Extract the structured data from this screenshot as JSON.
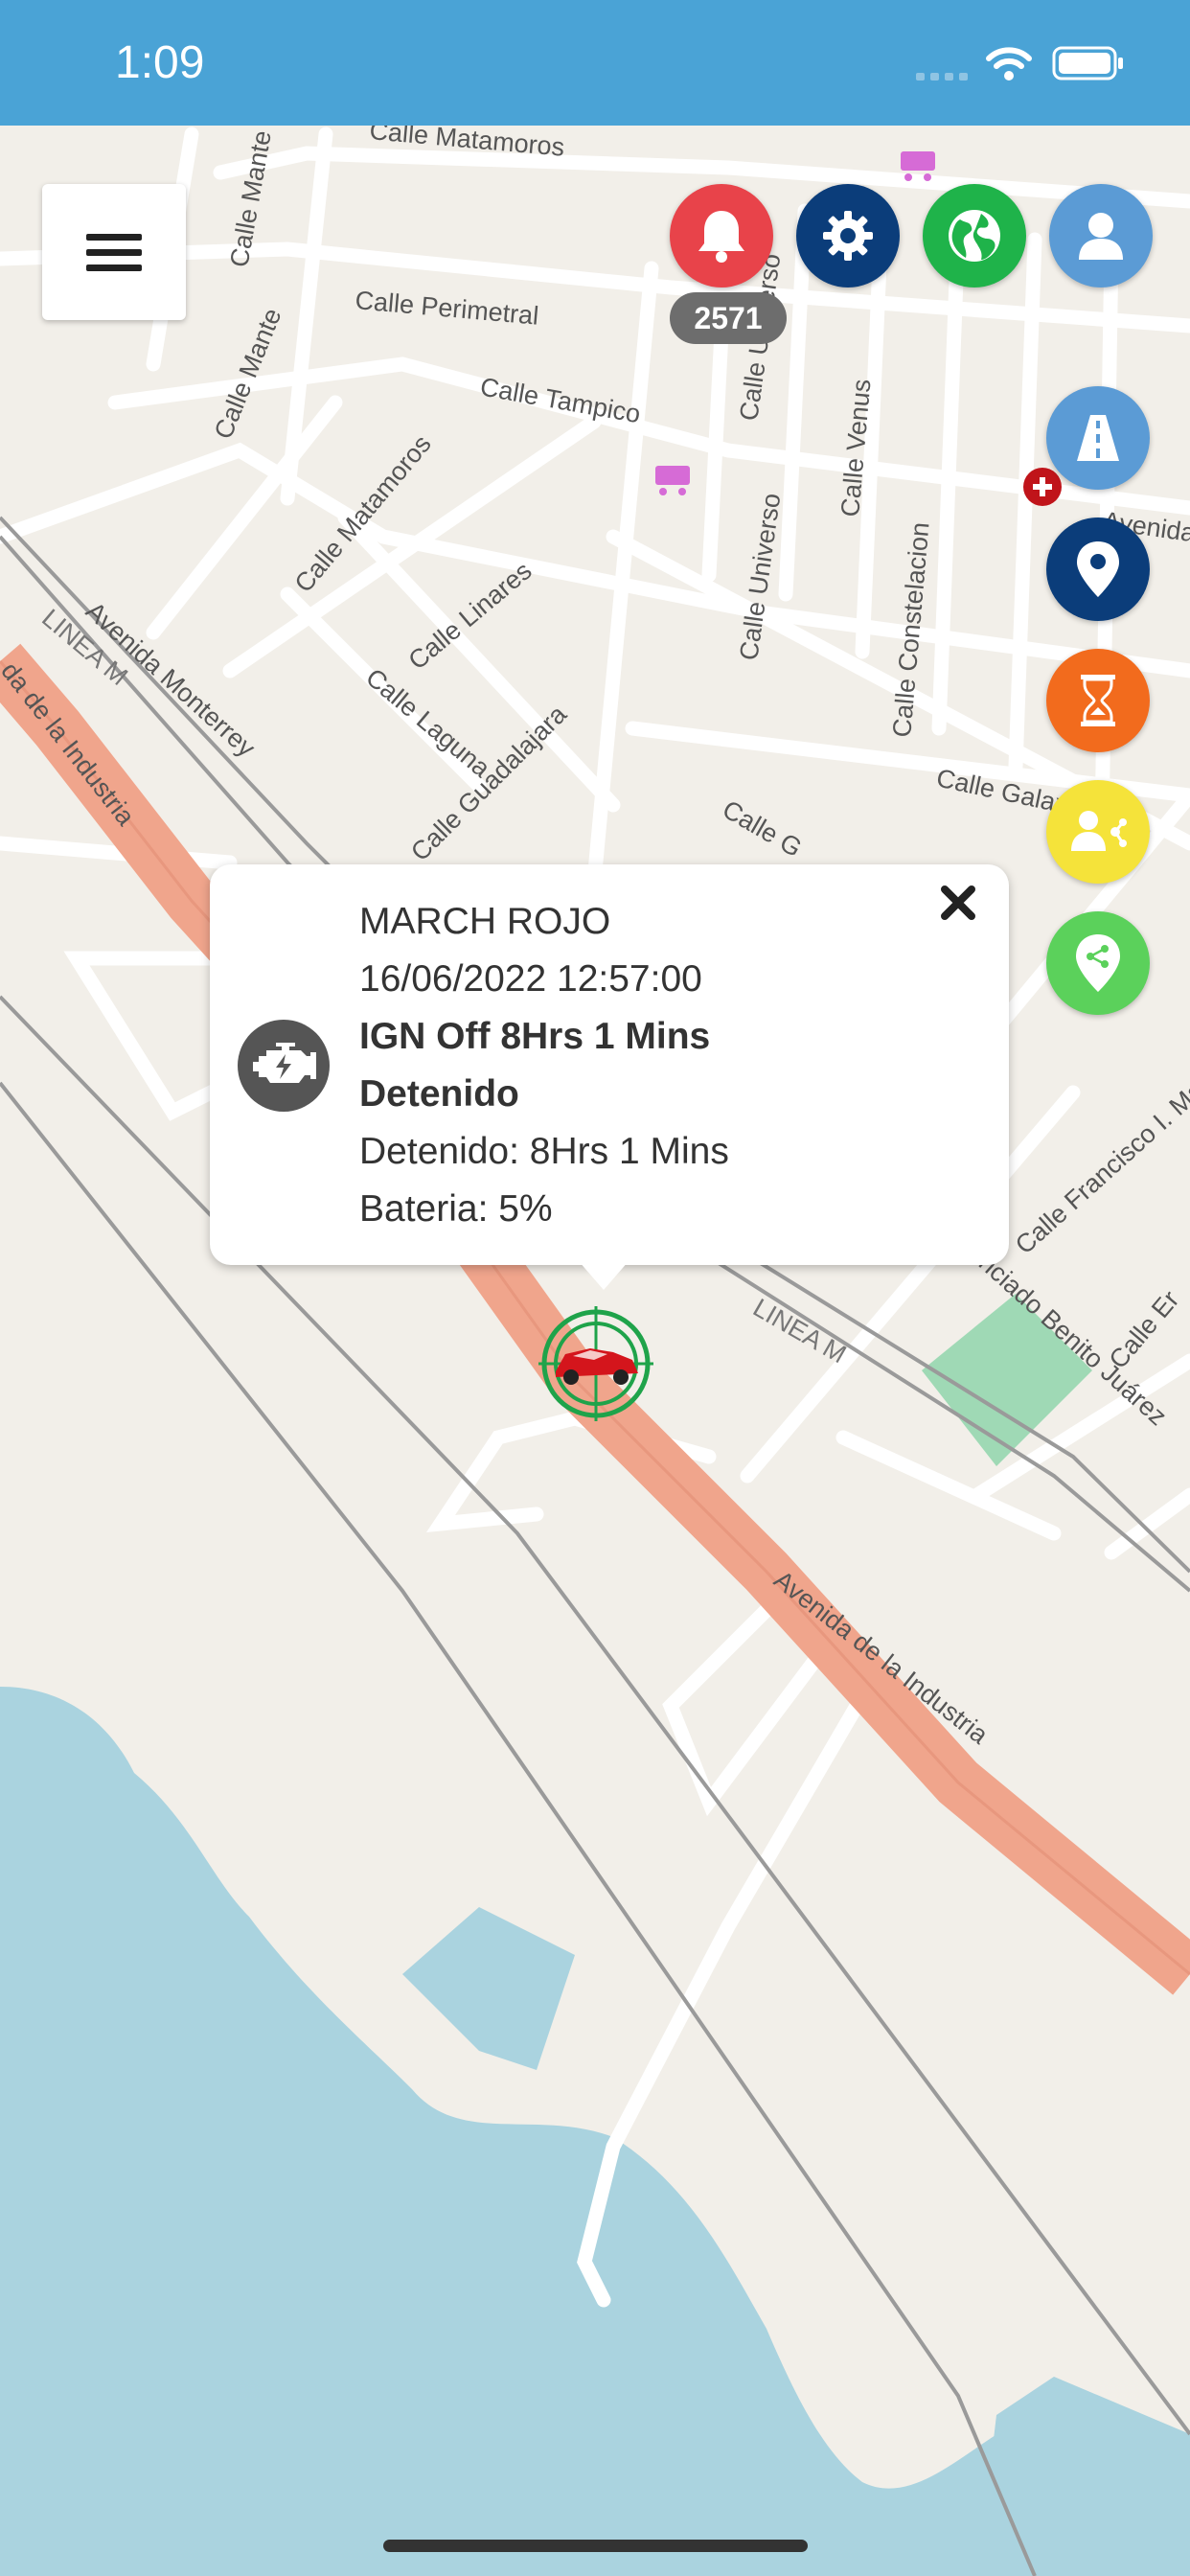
{
  "status_bar": {
    "time": "1:09"
  },
  "header": {
    "menu_icon": "hamburger-menu-icon",
    "alerts_icon": "bell-icon",
    "alerts_count": "2571",
    "settings_icon": "gear-icon",
    "map_layer_icon": "globe-icon",
    "profile_icon": "user-icon"
  },
  "side_actions": [
    {
      "icon": "road-icon",
      "color": "#5b9bd5"
    },
    {
      "icon": "location-pin-icon",
      "color": "#0b3d7a"
    },
    {
      "icon": "hourglass-icon",
      "color": "#f26b1d"
    },
    {
      "icon": "share-users-icon",
      "color": "#f5e33a"
    },
    {
      "icon": "share-location-icon",
      "color": "#5bd15b"
    }
  ],
  "map": {
    "streets": {
      "matamoros_top": "Calle Matamoros",
      "perimetral": "Calle Perimetral",
      "tampico": "Calle Tampico",
      "mante_1": "Calle Mante",
      "mante_2": "Calle Mante",
      "matamoros_diag": "Calle Matamoros",
      "linares": "Calle Linares",
      "laguna": "Calle Laguna",
      "guadalajara": "Calle Guadalajara",
      "av_monterrey": "Avenida Monterrey",
      "linea_m_1": "LINEA M",
      "linea_m_2": "LINEA M",
      "av_industria_1": "da de la Industria",
      "av_industria_2": "Avenida de la Industria",
      "universo_1": "Calle Universo",
      "universo_2": "Calle Universo",
      "venus": "Calle Venus",
      "constelacion": "Calle Constelacion",
      "galax": "Calle Galax",
      "calle_g": "Calle G",
      "francisco_madero": "Calle Francisco I. Made",
      "benito_juarez": "nciado Benito Juárez",
      "calle_er": "Calle Er",
      "avenida_right": "Avenida"
    }
  },
  "popup": {
    "title": "MARCH ROJO",
    "datetime": "16/06/2022 12:57:00",
    "ignition": "IGN Off 8Hrs 1 Mins",
    "state": "Detenido",
    "stopped": "Detenido: 8Hrs 1 Mins",
    "battery": "Bateria: 5%",
    "status_icon": "engine-icon",
    "close_icon": "close-icon"
  },
  "vehicle_marker": {
    "icon": "red-car-icon"
  },
  "colors": {
    "status_bar": "#4aa3d6",
    "alerts": "#e8434a",
    "settings": "#0b3d7a",
    "globe": "#1fb34a",
    "profile": "#5b9bd5",
    "highway": "#f0a58c",
    "water": "#aad3df"
  }
}
